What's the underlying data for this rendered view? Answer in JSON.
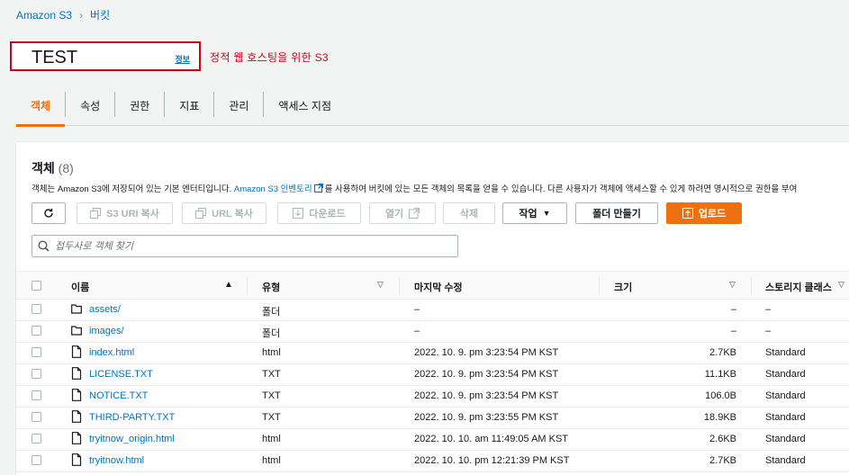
{
  "breadcrumb": {
    "root": "Amazon S3",
    "separator": "›",
    "current": "버킷"
  },
  "header": {
    "title": "TEST",
    "info": "정보",
    "annotation": "정적 웹 호스팅을 위한 S3"
  },
  "tabs": [
    {
      "label": "객체",
      "active": true
    },
    {
      "label": "속성"
    },
    {
      "label": "권한"
    },
    {
      "label": "지표"
    },
    {
      "label": "관리"
    },
    {
      "label": "액세스 지점"
    }
  ],
  "objects_panel": {
    "title": "객체",
    "count": "(8)",
    "desc_before": "객체는 Amazon S3에 저장되어 있는 기본 엔터티입니다. ",
    "desc_link": "Amazon S3 인벤토리",
    "desc_after": "를 사용하여 버킷에 있는 모든 객체의 목록을 얻을 수 있습니다. 다른 사용자가 객체에 액세스할 수 있게 하려면 명시적으로 권한을 부여",
    "toolbar": {
      "refresh_icon": "refresh-icon",
      "copy_s3_uri": "S3 URI 복사",
      "copy_url": "URL 복사",
      "download": "다운로드",
      "open": "열기",
      "delete": "삭제",
      "actions": "작업",
      "create_folder": "폴더 만들기",
      "upload": "업로드"
    },
    "search_placeholder": "접두사로 객체 찾기",
    "columns": {
      "name": "이름",
      "type": "유형",
      "modified": "마지막 수정",
      "size": "크기",
      "storage": "스토리지 클래스"
    },
    "rows": [
      {
        "icon": "folder-icon",
        "name": "assets/",
        "type": "폴더",
        "modified": "–",
        "size": "–",
        "storage": "–"
      },
      {
        "icon": "folder-icon",
        "name": "images/",
        "type": "폴더",
        "modified": "–",
        "size": "–",
        "storage": "–"
      },
      {
        "icon": "file-icon",
        "name": "index.html",
        "type": "html",
        "modified": "2022. 10. 9. pm 3:23:54 PM KST",
        "size": "2.7KB",
        "storage": "Standard"
      },
      {
        "icon": "file-icon",
        "name": "LICENSE.TXT",
        "type": "TXT",
        "modified": "2022. 10. 9. pm 3:23:54 PM KST",
        "size": "11.1KB",
        "storage": "Standard"
      },
      {
        "icon": "file-icon",
        "name": "NOTICE.TXT",
        "type": "TXT",
        "modified": "2022. 10. 9. pm 3:23:54 PM KST",
        "size": "106.0B",
        "storage": "Standard"
      },
      {
        "icon": "file-icon",
        "name": "THIRD-PARTY.TXT",
        "type": "TXT",
        "modified": "2022. 10. 9. pm 3:23:55 PM KST",
        "size": "18.9KB",
        "storage": "Standard"
      },
      {
        "icon": "file-icon",
        "name": "tryitnow_origin.html",
        "type": "html",
        "modified": "2022. 10. 10. am 11:49:05 AM KST",
        "size": "2.6KB",
        "storage": "Standard"
      },
      {
        "icon": "file-icon",
        "name": "tryitnow.html",
        "type": "html",
        "modified": "2022. 10. 10. pm 12:21:39 PM KST",
        "size": "2.7KB",
        "storage": "Standard"
      }
    ]
  },
  "colors": {
    "accent": "#ec7211",
    "link": "#0073bb",
    "highlight_box": "#d0021b"
  }
}
